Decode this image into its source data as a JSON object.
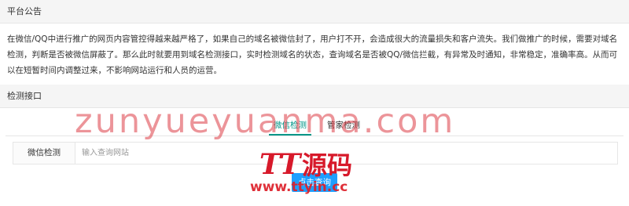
{
  "notice": {
    "title": "平台公告",
    "text": "在微信/QQ中进行推广的网页内容管控得越来越严格了，如果自己的域名被微信封了，用户打不开，会造成很大的流量损失和客户流失。我们做推广的时候，需要对域名检测，判断是否被微信屏蔽了。那么此时就要用到域名检测接口，实时检测域名的状态，查询域名是否被QQ/微信拦截，有异常及时通知，非常稳定，准确率高。从而可以在短暂时间内调整过来，不影响网站运行和人员的运营。"
  },
  "checker": {
    "title": "检测接口",
    "tabs": [
      {
        "label": "微信检测",
        "active": true
      },
      {
        "label": "管家检测",
        "active": false
      }
    ],
    "field_label": "微信检测",
    "input_placeholder": "输入查询网站",
    "input_value": "",
    "submit_label": "点击查询"
  },
  "watermark": {
    "text": "zunyueyuanma.com",
    "logo_text": "TT源码",
    "url": "www.ttyin.cc"
  },
  "colors": {
    "accent": "#009688",
    "button": "#1e9fff",
    "watermark": "#dc3c46"
  }
}
